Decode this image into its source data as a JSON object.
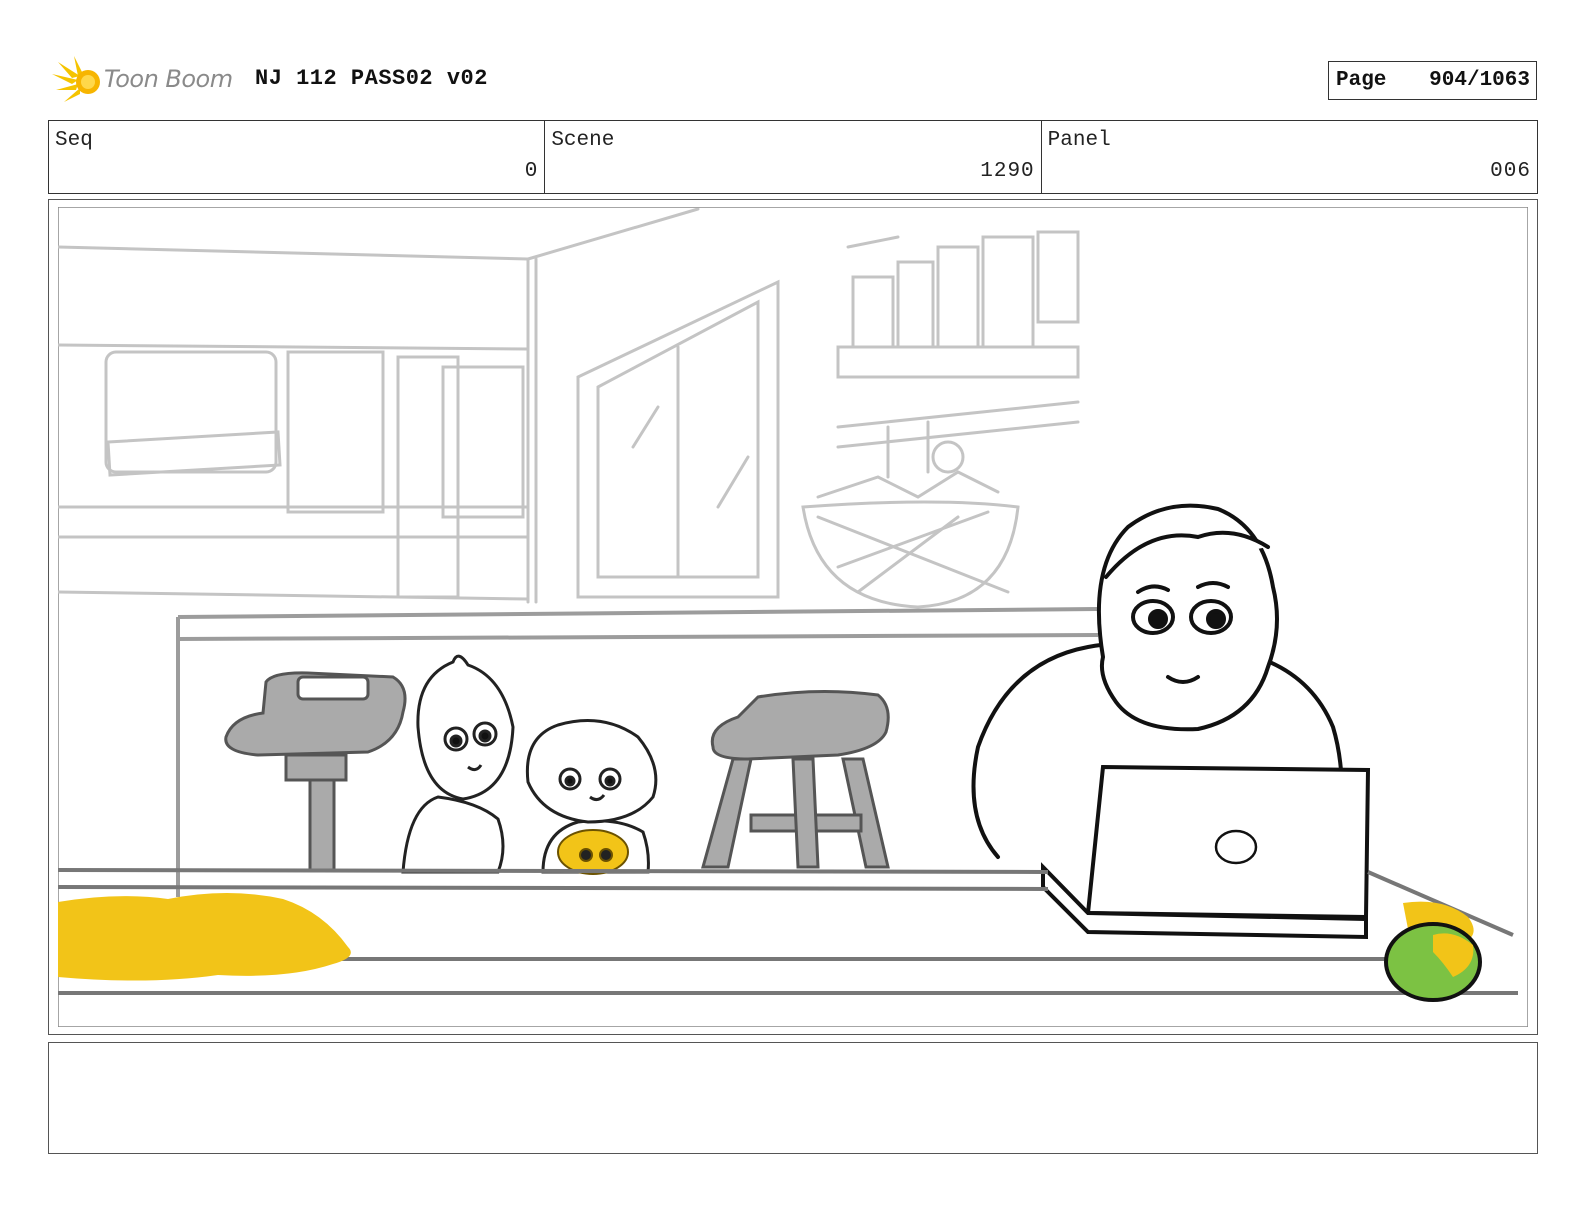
{
  "header": {
    "brand": "Toon Boom",
    "title": "NJ 112 PASS02 v02",
    "page_label": "Page",
    "page_value": "904/1063"
  },
  "info": {
    "seq_label": "Seq",
    "seq_value": "0",
    "scene_label": "Scene",
    "scene_value": "1290",
    "panel_label": "Panel",
    "panel_value": "006"
  },
  "notes": {
    "text": ""
  },
  "colors": {
    "highlight_yellow": "#f2c418",
    "mango_green": "#7cc243",
    "sketch_gray": "#bdbdbd",
    "stool_gray": "#a9a9a9"
  }
}
